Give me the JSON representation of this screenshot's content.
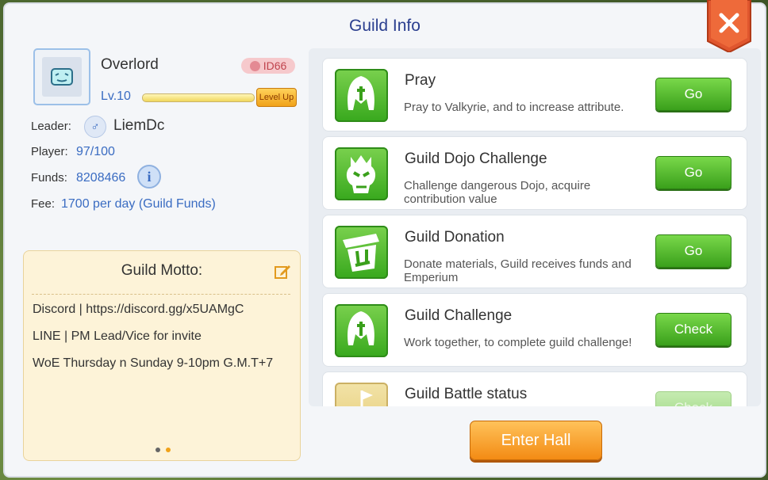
{
  "window": {
    "title": "Guild Info"
  },
  "guild": {
    "name": "Overlord",
    "id": "ID66",
    "level": "Lv.10",
    "level_up": "Level Up",
    "leader_label": "Leader:",
    "leader": "LiemDc",
    "player_label": "Player:",
    "players": "97/100",
    "funds_label": "Funds:",
    "funds": "8208466",
    "fee_label": "Fee:",
    "fee": "1700 per day (Guild Funds)"
  },
  "motto": {
    "title": "Guild Motto:",
    "lines": [
      "Discord | https://discord.gg/x5UAMgC",
      "LINE | PM Lead/Vice for invite",
      "WoE Thursday n Sunday 9-10pm G.M.T+7"
    ],
    "page": 2,
    "pages": 2
  },
  "activities": [
    {
      "title": "Pray",
      "desc": "Pray to Valkyrie, and to increase attribute.",
      "button": "Go",
      "icon": "valkyrie-icon"
    },
    {
      "title": "Guild Dojo Challenge",
      "desc": "Challenge dangerous Dojo, acquire contribution value",
      "button": "Go",
      "icon": "demon-skull-icon"
    },
    {
      "title": "Guild Donation",
      "desc": "Donate materials, Guild receives funds and Emperium",
      "button": "Go",
      "icon": "donation-box-icon"
    },
    {
      "title": "Guild Challenge",
      "desc": "Work together, to complete guild challenge!",
      "button": "Check",
      "icon": "valkyrie-icon"
    },
    {
      "title": "Guild Battle status",
      "desc": "",
      "button": "Check",
      "icon": "castle-flag-icon"
    }
  ],
  "footer": {
    "enter_hall": "Enter Hall"
  }
}
